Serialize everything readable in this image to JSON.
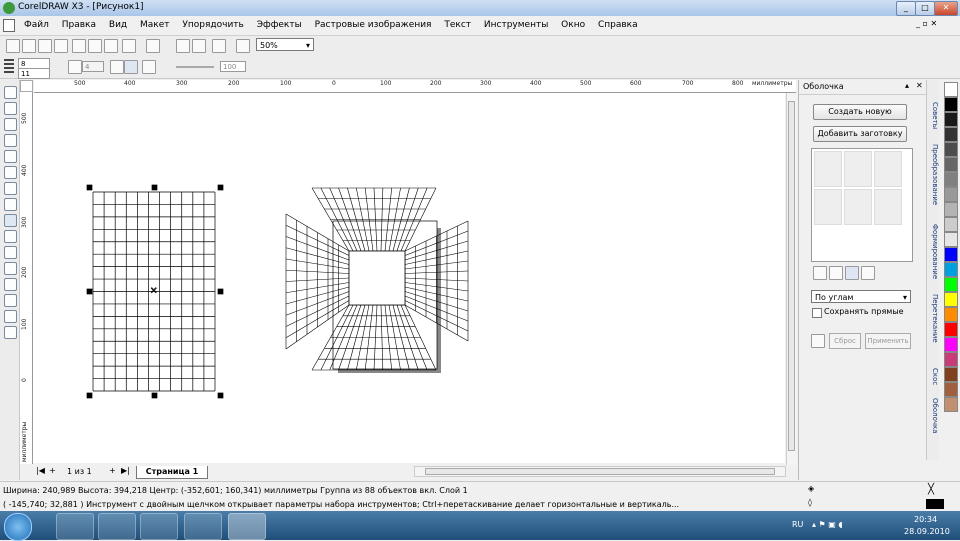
{
  "window": {
    "title": "CorelDRAW X3 - [Рисунок1]",
    "btn_min": "_",
    "btn_max": "□",
    "btn_close": "✕"
  },
  "menu": [
    "Файл",
    "Правка",
    "Вид",
    "Макет",
    "Упорядочить",
    "Эффекты",
    "Растровые изображения",
    "Текст",
    "Инструменты",
    "Окно",
    "Справка"
  ],
  "toolbar": {
    "zoom": "50%"
  },
  "propbar": {
    "width_val": "8",
    "height_val": "11",
    "steps_val": "4",
    "slider_val": "100"
  },
  "ruler": {
    "top_labels": [
      "500",
      "400",
      "300",
      "200",
      "100",
      "0",
      "100",
      "200",
      "300",
      "400",
      "500",
      "600",
      "700",
      "800",
      "миллиметры"
    ],
    "left_labels": [
      "500",
      "400",
      "300",
      "200",
      "100",
      "0",
      "миллиметры"
    ]
  },
  "pages": {
    "counter": "1 из 1",
    "tab": "Страница 1"
  },
  "docker": {
    "title": "Оболочка",
    "create_new": "Создать новую",
    "add_preset": "Добавить заготовку",
    "mode": "По углам",
    "keep_lines": "Сохранять прямые",
    "reset": "Сброс",
    "apply": "Применить",
    "tabs": [
      "Советы",
      "Преобразование",
      "Формирование",
      "Перетекание",
      "Скос",
      "Оболочка"
    ]
  },
  "status": {
    "line1": "Ширина: 240,989  Высота: 394,218  Центр: (-352,601; 160,341)  миллиметры    Группа из 88 объектов вкл. Слой 1",
    "line2": "( -145,740; 32,881 )     Инструмент с двойным щелчком открывает параметры набора инструментов; Ctrl+перетаскивание делает горизонтальные и вертикаль..."
  },
  "taskbar": {
    "lang": "RU",
    "time": "20:34",
    "date": "28.09.2010"
  },
  "palette": [
    "#ffffff",
    "#000000",
    "#1a1a1a",
    "#333333",
    "#4d4d4d",
    "#666666",
    "#808080",
    "#999999",
    "#b3b3b3",
    "#cccccc",
    "#e6e6e6",
    "#0000ff",
    "#00a0e0",
    "#00ff00",
    "#ffff00",
    "#ff8c00",
    "#ff0000",
    "#ff00ff",
    "#c83c78",
    "#804020",
    "#a06040",
    "#c09070"
  ]
}
